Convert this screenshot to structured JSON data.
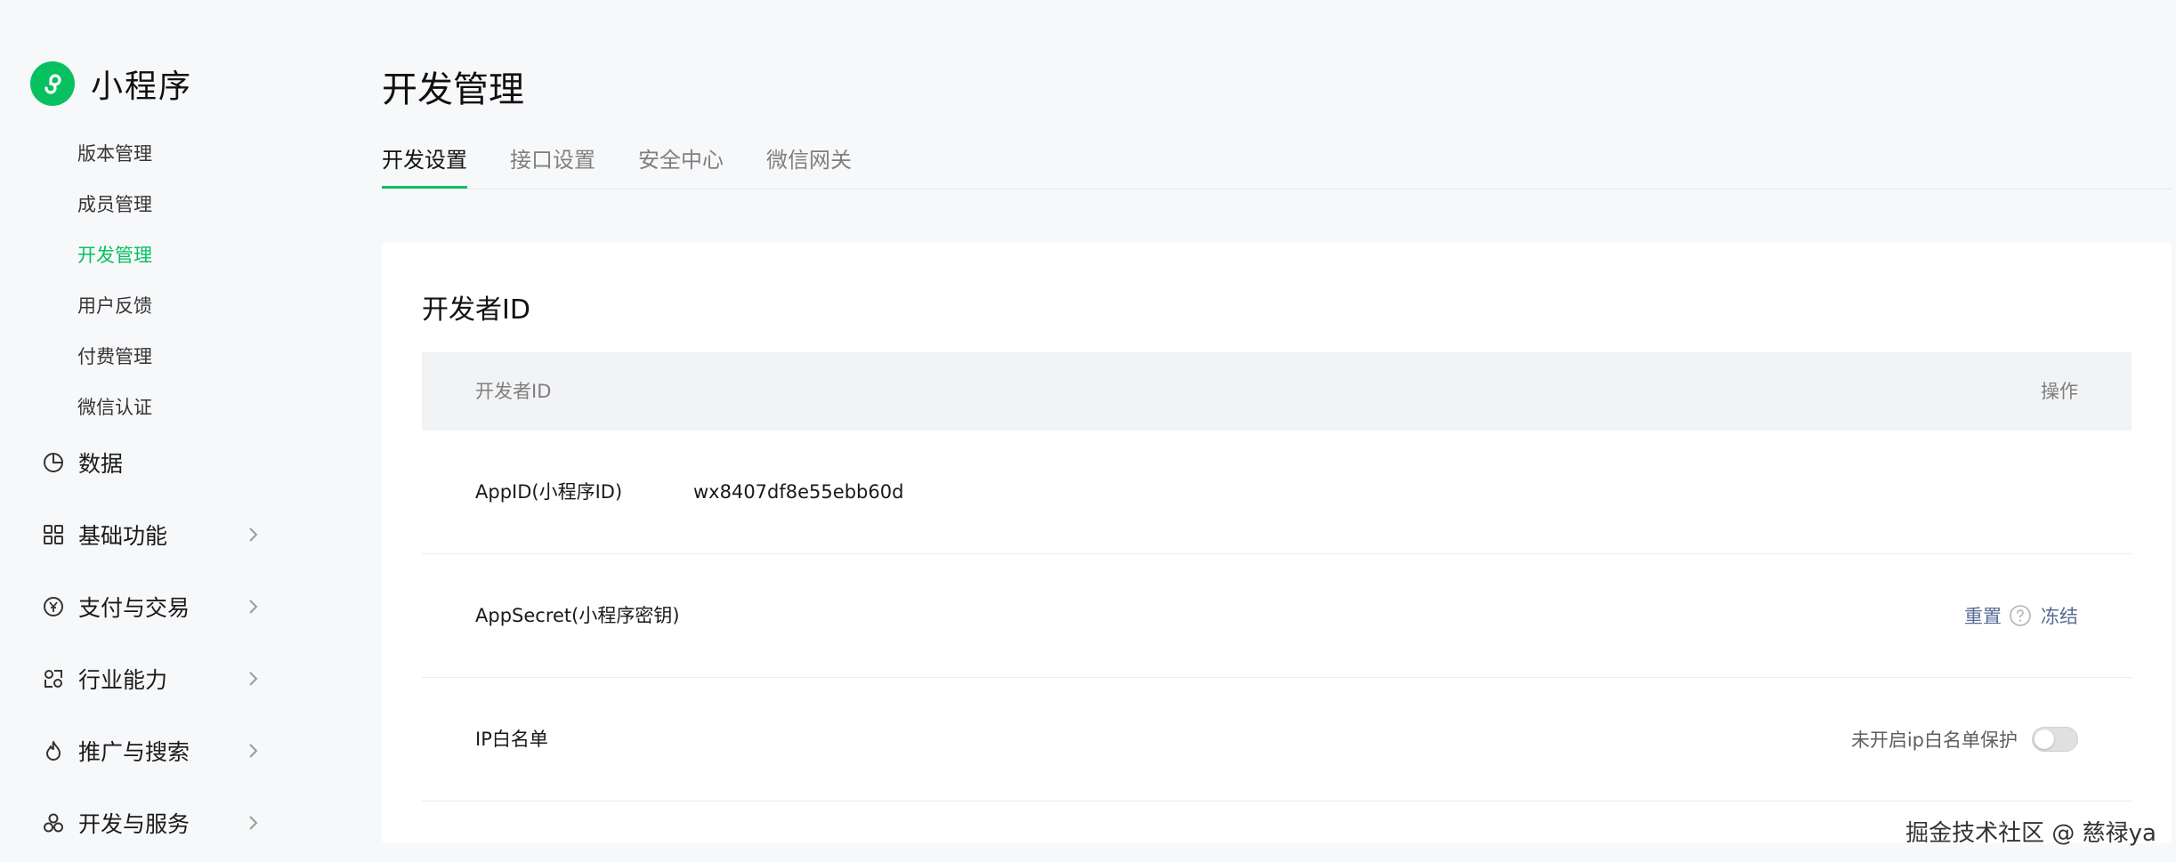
{
  "brand": {
    "name": "小程序",
    "logo_icon": "miniprogram-logo-icon",
    "color": "#07c160"
  },
  "sidebar": {
    "sub_items": [
      {
        "label": "版本管理"
      },
      {
        "label": "成员管理"
      },
      {
        "label": "开发管理",
        "active": true
      },
      {
        "label": "用户反馈"
      },
      {
        "label": "付费管理"
      },
      {
        "label": "微信认证"
      }
    ],
    "groups": [
      {
        "label": "数据",
        "icon": "pie-chart-icon"
      },
      {
        "label": "基础功能",
        "icon": "grid-icon"
      },
      {
        "label": "支付与交易",
        "icon": "yen-icon"
      },
      {
        "label": "行业能力",
        "icon": "industry-icon"
      },
      {
        "label": "推广与搜索",
        "icon": "flame-icon"
      },
      {
        "label": "开发与服务",
        "icon": "services-icon"
      }
    ]
  },
  "page": {
    "title": "开发管理"
  },
  "tabs": [
    {
      "label": "开发设置",
      "active": true
    },
    {
      "label": "接口设置"
    },
    {
      "label": "安全中心"
    },
    {
      "label": "微信网关"
    }
  ],
  "card": {
    "title": "开发者ID",
    "table": {
      "col_id": "开发者ID",
      "col_action": "操作"
    },
    "rows": {
      "appid": {
        "label": "AppID(小程序ID)",
        "value": "wx8407df8e55ebb60d"
      },
      "secret": {
        "label": "AppSecret(小程序密钥)",
        "reset": "重置",
        "freeze": "冻结"
      },
      "ip": {
        "label": "IP白名单",
        "status": "未开启ip白名单保护",
        "enabled": false
      }
    }
  },
  "watermark": "掘金技术社区 @ 慈禄ya"
}
